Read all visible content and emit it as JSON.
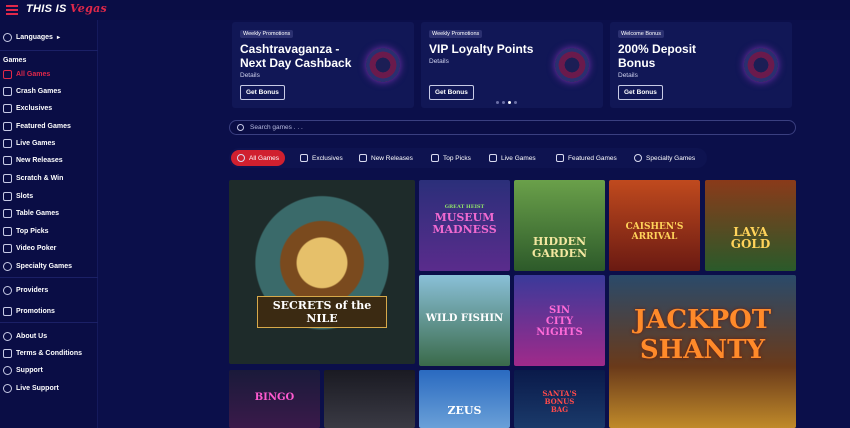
{
  "header": {
    "logo_prefix": "THIS IS",
    "logo_brand": "Vegas"
  },
  "sidebar": {
    "languages": "Languages",
    "games_heading": "Games",
    "games": [
      "All Games",
      "Crash Games",
      "Exclusives",
      "Featured Games",
      "Live Games",
      "New Releases",
      "Scratch & Win",
      "Slots",
      "Table Games",
      "Top Picks",
      "Video Poker",
      "Specialty Games"
    ],
    "providers": "Providers",
    "promotions": "Promotions",
    "footer": [
      "About Us",
      "Terms & Conditions",
      "Support",
      "Live Support"
    ]
  },
  "promos": [
    {
      "tag": "Weekly Promotions",
      "title": "Cashtravaganza - Next Day Cashback",
      "details": "Details",
      "button": "Get Bonus"
    },
    {
      "tag": "Weekly Promotions",
      "title": "VIP Loyalty Points",
      "details": "Details",
      "button": "Get Bonus"
    },
    {
      "tag": "Welcome Bonus",
      "title": "200% Deposit Bonus",
      "details": "Details",
      "button": "Get Bonus"
    }
  ],
  "search": {
    "placeholder": "Search games . . ."
  },
  "categories": [
    "All Games",
    "Exclusives",
    "New Releases",
    "Top Picks",
    "Live Games",
    "Featured Games",
    "Specialty Games"
  ],
  "games": [
    "SECRETS of the NILE",
    "MUSEUM MADNESS",
    "HIDDEN GARDEN",
    "CAISHEN'S ARRIVAL",
    "LAVA GOLD",
    "WILD FISHIN",
    "SIN CITY NIGHTS",
    "JACKPOT SHANTY",
    "BINGO",
    "",
    "ZEUS",
    "SANTA'S BONUS BAG"
  ],
  "game_tags": {
    "museum": "GREAT HEIST"
  },
  "colors": {
    "accent": "#e0284a",
    "background": "#0b0f4a",
    "panel": "#111756"
  }
}
